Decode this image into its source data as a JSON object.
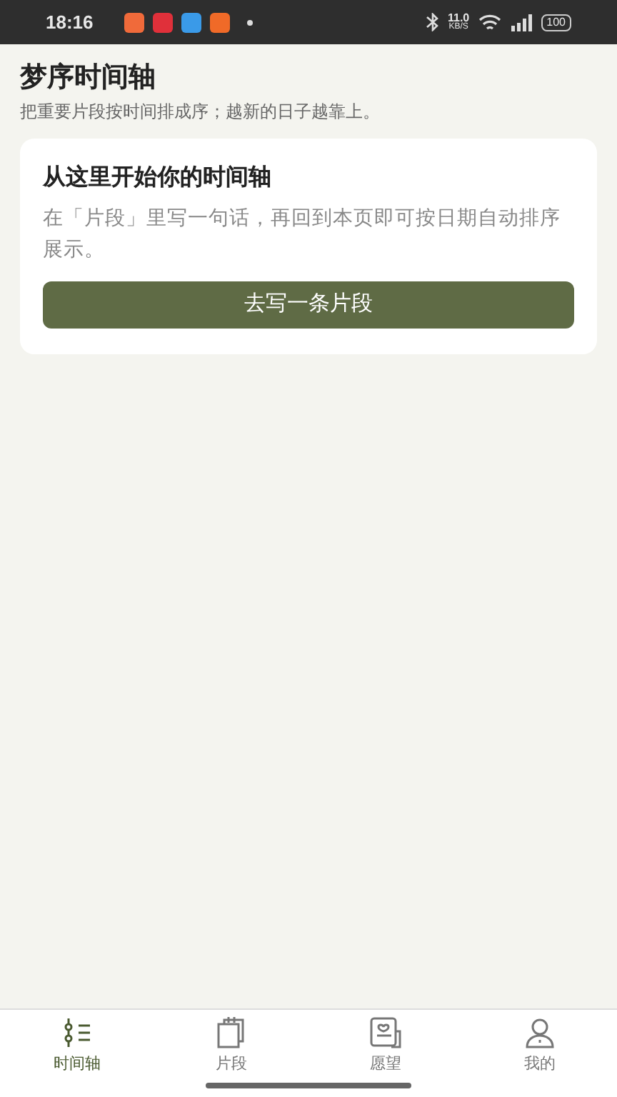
{
  "status_bar": {
    "time": "18:16",
    "speed": "11.0",
    "speed_unit": "KB/S",
    "battery": "100"
  },
  "header": {
    "title": "梦序时间轴",
    "subtitle": "把重要片段按时间排成序；越新的日子越靠上。"
  },
  "empty_card": {
    "title": "从这里开始你的时间轴",
    "body": "在「片段」里写一句话，再回到本页即可按日期自动排序展示。",
    "button": "去写一条片段"
  },
  "tabs": [
    {
      "kind": "timeline",
      "label": "时间轴",
      "selected": true
    },
    {
      "kind": "fragments",
      "label": "片段",
      "selected": false
    },
    {
      "kind": "wishes",
      "label": "愿望",
      "selected": false
    },
    {
      "kind": "me",
      "label": "我的",
      "selected": false
    }
  ]
}
